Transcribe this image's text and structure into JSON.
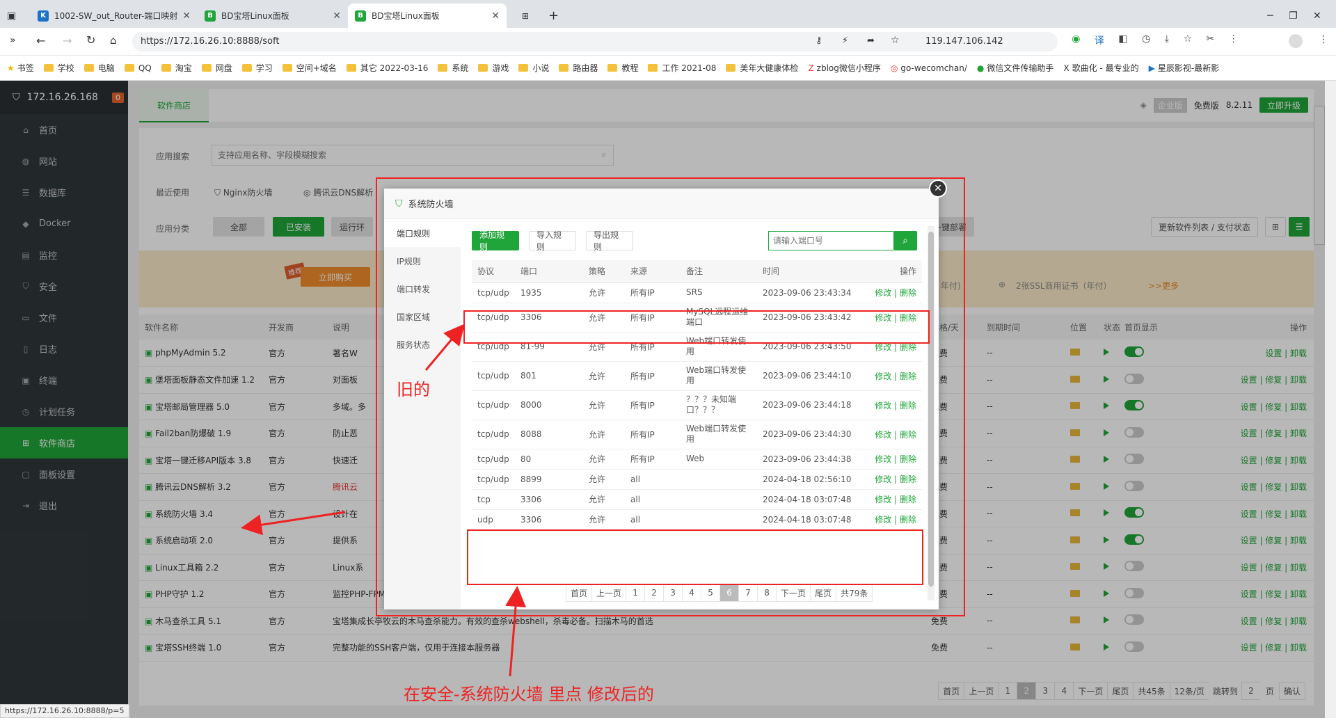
{
  "browser": {
    "tabs": [
      {
        "title": "1002-SW_out_Router-端口映射"
      },
      {
        "title": "BD宝塔Linux面板"
      },
      {
        "title": "BD宝塔Linux面板"
      }
    ],
    "url": "https://172.16.26.10:8888/soft",
    "ip_display": "119.147.106.142",
    "status_url": "https://172.16.26.10:8888/p=5",
    "bookmarks": [
      "书签",
      "学校",
      "电脑",
      "QQ",
      "淘宝",
      "网盘",
      "学习",
      "空间+域名",
      "其它 2022-03-16",
      "系统",
      "游戏",
      "小说",
      "路由器",
      "教程",
      "工作 2021-08",
      "美年大健康体检",
      "zblog微信小程序",
      "go-wecomchan/",
      "微信文件传输助手",
      "歌曲化 - 最专业的",
      "星辰影视-最新影"
    ]
  },
  "sidebar": {
    "server_ip": "172.16.26.168",
    "badge": "0",
    "items": [
      {
        "label": "首页",
        "icon": "home-icon"
      },
      {
        "label": "网站",
        "icon": "globe-icon"
      },
      {
        "label": "数据库",
        "icon": "database-icon"
      },
      {
        "label": "Docker",
        "icon": "docker-icon"
      },
      {
        "label": "监控",
        "icon": "monitor-icon"
      },
      {
        "label": "安全",
        "icon": "shield-icon"
      },
      {
        "label": "文件",
        "icon": "folder-icon"
      },
      {
        "label": "日志",
        "icon": "log-icon"
      },
      {
        "label": "终端",
        "icon": "terminal-icon"
      },
      {
        "label": "计划任务",
        "icon": "clock-icon"
      },
      {
        "label": "软件商店",
        "icon": "grid-icon"
      },
      {
        "label": "面板设置",
        "icon": "settings-icon"
      },
      {
        "label": "退出",
        "icon": "logout-icon"
      }
    ]
  },
  "store": {
    "tab": "软件商店",
    "edition": "企业版",
    "free": "免费版",
    "version": "8.2.11",
    "upgrade": "立即升级",
    "search_label": "应用搜索",
    "search_placeholder": "支持应用名称、字段模糊搜索",
    "recent_label": "最近使用",
    "recent": [
      "Nginx防火墙",
      "腾讯云DNS解析"
    ],
    "category_label": "应用分类",
    "categories": [
      "全部",
      "已安装",
      "运行环"
    ],
    "category_right": "一键部署",
    "list_btn": "更新软件列表 / 支付状态",
    "banner_buy": "立即购买",
    "banner_hot": "推荐",
    "banner_mid": "年付)",
    "banner_ssl": "2张SSL商用证书（年付）",
    "banner_more": ">>更多",
    "headers": [
      "软件名称",
      "开发商",
      "说明",
      "价格/天",
      "到期时间",
      "位置",
      "状态",
      "首页显示",
      "操作"
    ],
    "rows": [
      {
        "name": "phpMyAdmin 5.2",
        "dev": "官方",
        "desc": "著名W",
        "price": "免费",
        "exp": "--",
        "on": true,
        "ops": "设置 | 卸载"
      },
      {
        "name": "堡塔面板静态文件加速 1.2",
        "dev": "官方",
        "desc": "对面板",
        "price": "免费",
        "exp": "--",
        "on": false,
        "ops": "设置 | 修复 | 卸载"
      },
      {
        "name": "宝塔邮局管理器 5.0",
        "dev": "官方",
        "desc": "多域。多",
        "price": "免费",
        "exp": "--",
        "on": true,
        "ops": "设置 | 修复 | 卸载"
      },
      {
        "name": "Fail2ban防爆破 1.9",
        "dev": "官方",
        "desc": "防止恶",
        "price": "免费",
        "exp": "--",
        "on": false,
        "ops": "设置 | 修复 | 卸载"
      },
      {
        "name": "宝塔一键迁移API版本 3.8",
        "dev": "官方",
        "desc": "快速迁",
        "price": "免费",
        "exp": "--",
        "on": false,
        "ops": "设置 | 修复 | 卸载"
      },
      {
        "name": "腾讯云DNS解析 3.2",
        "dev": "官方",
        "desc": "腾讯云",
        "price": "免费",
        "exp": "--",
        "on": false,
        "ops": "设置 | 修复 | 卸载"
      },
      {
        "name": "系统防火墙 3.4",
        "dev": "官方",
        "desc": "设计在",
        "price": "免费",
        "exp": "--",
        "on": true,
        "ops": "设置 | 修复 | 卸载"
      },
      {
        "name": "系统启动项 2.0",
        "dev": "官方",
        "desc": "提供系",
        "price": "免费",
        "exp": "--",
        "on": true,
        "ops": "设置 | 修复 | 卸载"
      },
      {
        "name": "Linux工具箱 2.2",
        "dev": "官方",
        "desc": "Linux系",
        "price": "免费",
        "exp": "--",
        "on": false,
        "ops": "设置 | 修复 | 卸载"
      },
      {
        "name": "PHP守护 1.2",
        "dev": "官方",
        "desc": "监控PHP-FPM运行状态，防止大批量出现502错误",
        "price": "免费",
        "exp": "--",
        "on": false,
        "ops": "设置 | 修复 | 卸载"
      },
      {
        "name": "木马查杀工具 5.1",
        "dev": "官方",
        "desc": "宝塔集成长亭牧云的木马查杀能力。有效的查杀webshell，杀毒必备。扫描木马的首选",
        "price": "免费",
        "exp": "--",
        "on": false,
        "ops": "设置 | 修复 | 卸载"
      },
      {
        "name": "宝塔SSH终端 1.0",
        "dev": "官方",
        "desc": "完整功能的SSH客户端，仅用于连接本服务器",
        "price": "免费",
        "exp": "--",
        "on": false,
        "ops": "设置 | 修复 | 卸载"
      }
    ],
    "pager": [
      "首页",
      "上一页",
      "1",
      "2",
      "3",
      "4",
      "下一页",
      "尾页",
      "共45条",
      "12条/页",
      "跳转到",
      "2",
      "页",
      "确认"
    ]
  },
  "modal": {
    "title": "系统防火墙",
    "menu": [
      "端口规则",
      "IP规则",
      "端口转发",
      "国家区域",
      "服务状态"
    ],
    "add_btn": "添加规则",
    "import_btn": "导入规则",
    "export_btn": "导出规则",
    "port_placeholder": "请输入端口号",
    "headers": [
      "协议",
      "端口",
      "策略",
      "来源",
      "备注",
      "时间",
      "操作"
    ],
    "rules": [
      {
        "proto": "tcp/udp",
        "port": "1935",
        "policy": "允许",
        "src": "所有IP",
        "note": "SRS",
        "time": "2023-09-06 23:43:34"
      },
      {
        "proto": "tcp/udp",
        "port": "3306",
        "policy": "允许",
        "src": "所有IP",
        "note": "MySQL远程运维端口",
        "time": "2023-09-06 23:43:42"
      },
      {
        "proto": "tcp/udp",
        "port": "81-99",
        "policy": "允许",
        "src": "所有IP",
        "note": "Web端口转发使用",
        "time": "2023-09-06 23:43:50"
      },
      {
        "proto": "tcp/udp",
        "port": "801",
        "policy": "允许",
        "src": "所有IP",
        "note": "Web端口转发使用",
        "time": "2023-09-06 23:44:10"
      },
      {
        "proto": "tcp/udp",
        "port": "8000",
        "policy": "允许",
        "src": "所有IP",
        "note": "？？？未知端口？？？",
        "time": "2023-09-06 23:44:18"
      },
      {
        "proto": "tcp/udp",
        "port": "8088",
        "policy": "允许",
        "src": "所有IP",
        "note": "Web端口转发使用",
        "time": "2023-09-06 23:44:30"
      },
      {
        "proto": "tcp/udp",
        "port": "80",
        "policy": "允许",
        "src": "所有IP",
        "note": "Web",
        "time": "2023-09-06 23:44:38"
      },
      {
        "proto": "tcp/udp",
        "port": "8899",
        "policy": "允许",
        "src": "all",
        "note": "",
        "time": "2024-04-18 02:56:10"
      },
      {
        "proto": "tcp",
        "port": "3306",
        "policy": "允许",
        "src": "all",
        "note": "",
        "time": "2024-04-18 03:07:48"
      },
      {
        "proto": "udp",
        "port": "3306",
        "policy": "允许",
        "src": "all",
        "note": "",
        "time": "2024-04-18 03:07:48"
      }
    ],
    "op_edit": "修改",
    "op_del": "删除",
    "pager": [
      "首页",
      "上一页",
      "1",
      "2",
      "3",
      "4",
      "5",
      "6",
      "7",
      "8",
      "下一页",
      "尾页",
      "共79条"
    ]
  },
  "annotations": {
    "old": "旧的",
    "new": "在安全-系统防火墙 里点 修改后的"
  },
  "colors": {
    "accent": "#20a53a",
    "annotation": "#e22222",
    "sidebar": "#30373b"
  }
}
